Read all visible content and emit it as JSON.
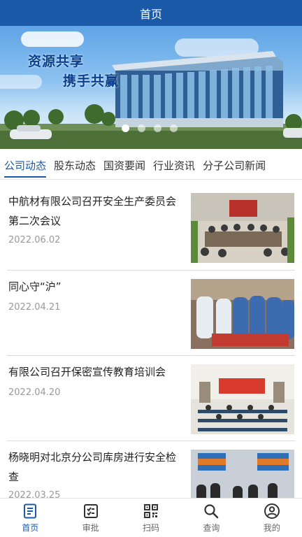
{
  "header": {
    "title": "首页"
  },
  "banner": {
    "slogan_line1": "资源共享",
    "slogan_line2": "携手共赢",
    "slide_count": 4,
    "active_slide": 1
  },
  "tabs": [
    {
      "label": "公司动态",
      "active": true
    },
    {
      "label": "股东动态",
      "active": false
    },
    {
      "label": "国资要闻",
      "active": false
    },
    {
      "label": "行业资讯",
      "active": false
    },
    {
      "label": "分子公司新闻",
      "active": false
    }
  ],
  "news": [
    {
      "title": "中航材有限公司召开安全生产委员会第二次会议",
      "date": "2022.06.02",
      "image": "meeting-photo"
    },
    {
      "title": "同心守“沪”",
      "date": "2022.04.21",
      "image": "medical-team-photo"
    },
    {
      "title": "有限公司召开保密宣传教育培训会",
      "date": "2022.04.20",
      "image": "training-hall-photo"
    },
    {
      "title": "杨晓明对北京分公司库房进行安全检查",
      "date": "2022.03.25",
      "image": "warehouse-photo"
    }
  ],
  "bottom_nav": [
    {
      "label": "首页",
      "icon": "news-icon",
      "active": true
    },
    {
      "label": "审批",
      "icon": "approval-icon",
      "active": false
    },
    {
      "label": "扫码",
      "icon": "qr-code-icon",
      "active": false
    },
    {
      "label": "查询",
      "icon": "search-icon",
      "active": false
    },
    {
      "label": "我的",
      "icon": "user-icon",
      "active": false
    }
  ],
  "colors": {
    "primary": "#1a5aa8",
    "text": "#222222",
    "muted": "#999999"
  }
}
